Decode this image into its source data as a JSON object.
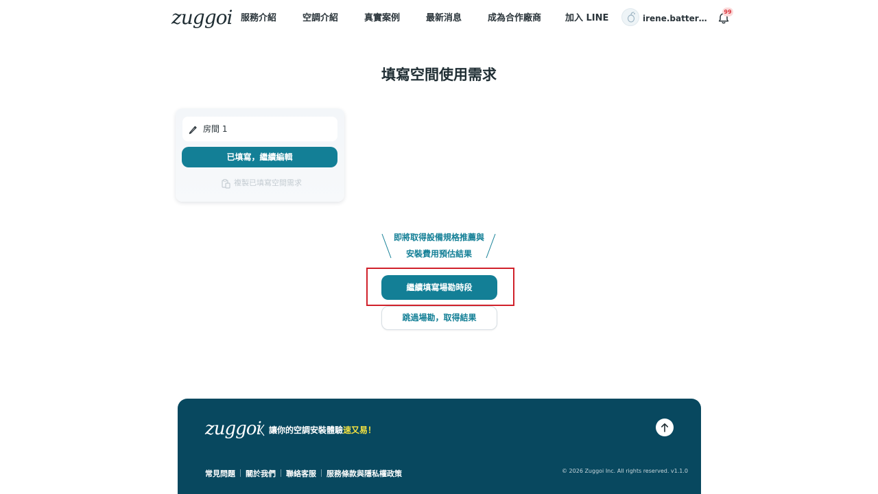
{
  "header": {
    "logo": "zuggoi",
    "nav": [
      {
        "label": "服務介紹"
      },
      {
        "label": "空調介紹"
      },
      {
        "label": "真實案例"
      },
      {
        "label": "最新消息"
      },
      {
        "label": "成為合作廠商"
      },
      {
        "label": "加入 LINE"
      }
    ],
    "user_email": "irene.batter@yahoo.com",
    "notification_count": "99"
  },
  "page": {
    "title": "填寫空間使用需求"
  },
  "room_card": {
    "room_name": "房間 1",
    "edit_button_label": "已填寫，繼續編輯",
    "copy_label": "複製已填寫空間需求"
  },
  "promo": {
    "line1": "即將取得設備規格推薦與",
    "line2": "安裝費用預估結果"
  },
  "actions": {
    "primary_label": "繼續填寫場勘時段",
    "secondary_label": "跳過場勘，取得結果"
  },
  "footer": {
    "logo": "zuggoi",
    "tagline_prefix": "讓你的空調安裝體驗",
    "tagline_accent": "速又易！",
    "links": [
      {
        "label": "常見問題"
      },
      {
        "label": "關於我們"
      },
      {
        "label": "聯絡客服"
      },
      {
        "label": "服務條款與隱私權政策"
      }
    ],
    "copyright": "© 2026 Zuggoi Inc. All rights reserved. v1.1.0"
  },
  "colors": {
    "brand_teal": "#137f96",
    "footer_navy": "#08485f",
    "accent_yellow": "#f4e240",
    "highlight_red": "#d0202a"
  }
}
